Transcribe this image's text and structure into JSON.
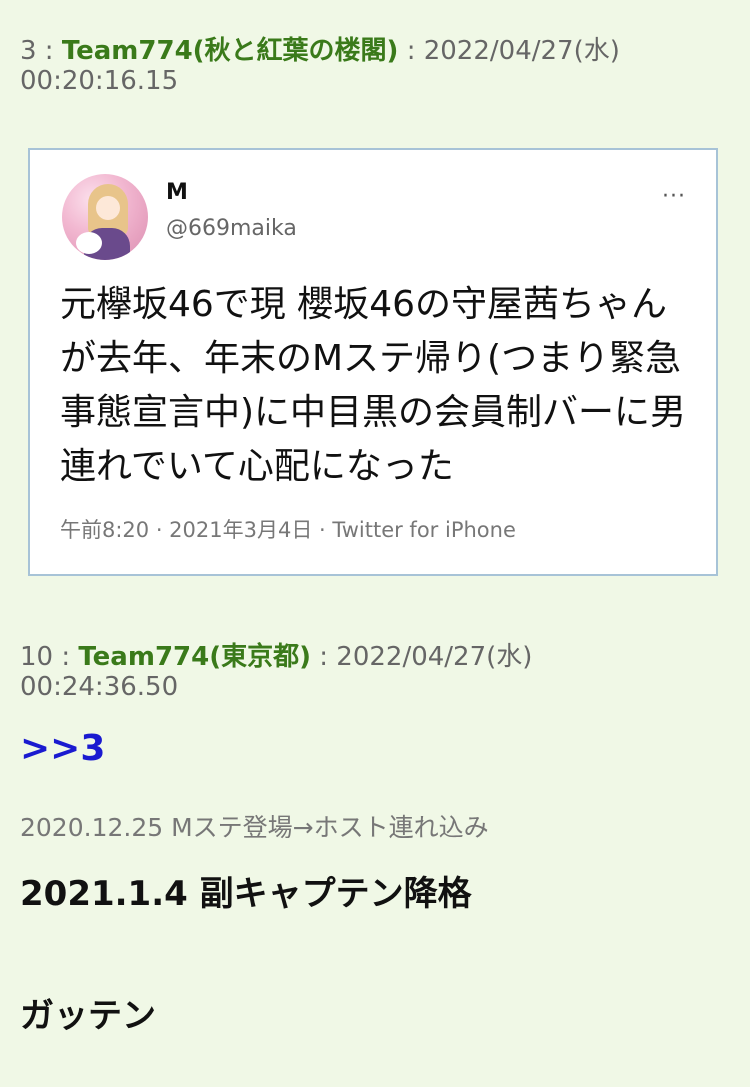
{
  "posts": [
    {
      "number": "3",
      "separator": " : ",
      "name": "Team774(秋と紅葉の楼閣)",
      "date": " : 2022/04/27(水)",
      "time": "00:20:16.15"
    },
    {
      "number": "10",
      "separator": " : ",
      "name": "Team774(東京都)",
      "date": " : 2022/04/27(水)",
      "time": "00:24:36.50"
    }
  ],
  "tweet": {
    "display_name": "M",
    "handle": "@669maika",
    "more_icon": "···",
    "text": "元欅坂46で現 櫻坂46の守屋茜ちゃんが去年、年末のMステ帰り(つまり緊急事態宣言中)に中目黒の会員制バーに男連れでいて心配になった",
    "meta": "午前8:20 · 2021年3月4日 · Twitter for iPhone"
  },
  "reply": {
    "anchor": ">>3",
    "line1": "2020.12.25 Mステ登場→ホスト連れ込み",
    "line2": "2021.1.4 副キャプテン降格",
    "line3": "ガッテン"
  }
}
